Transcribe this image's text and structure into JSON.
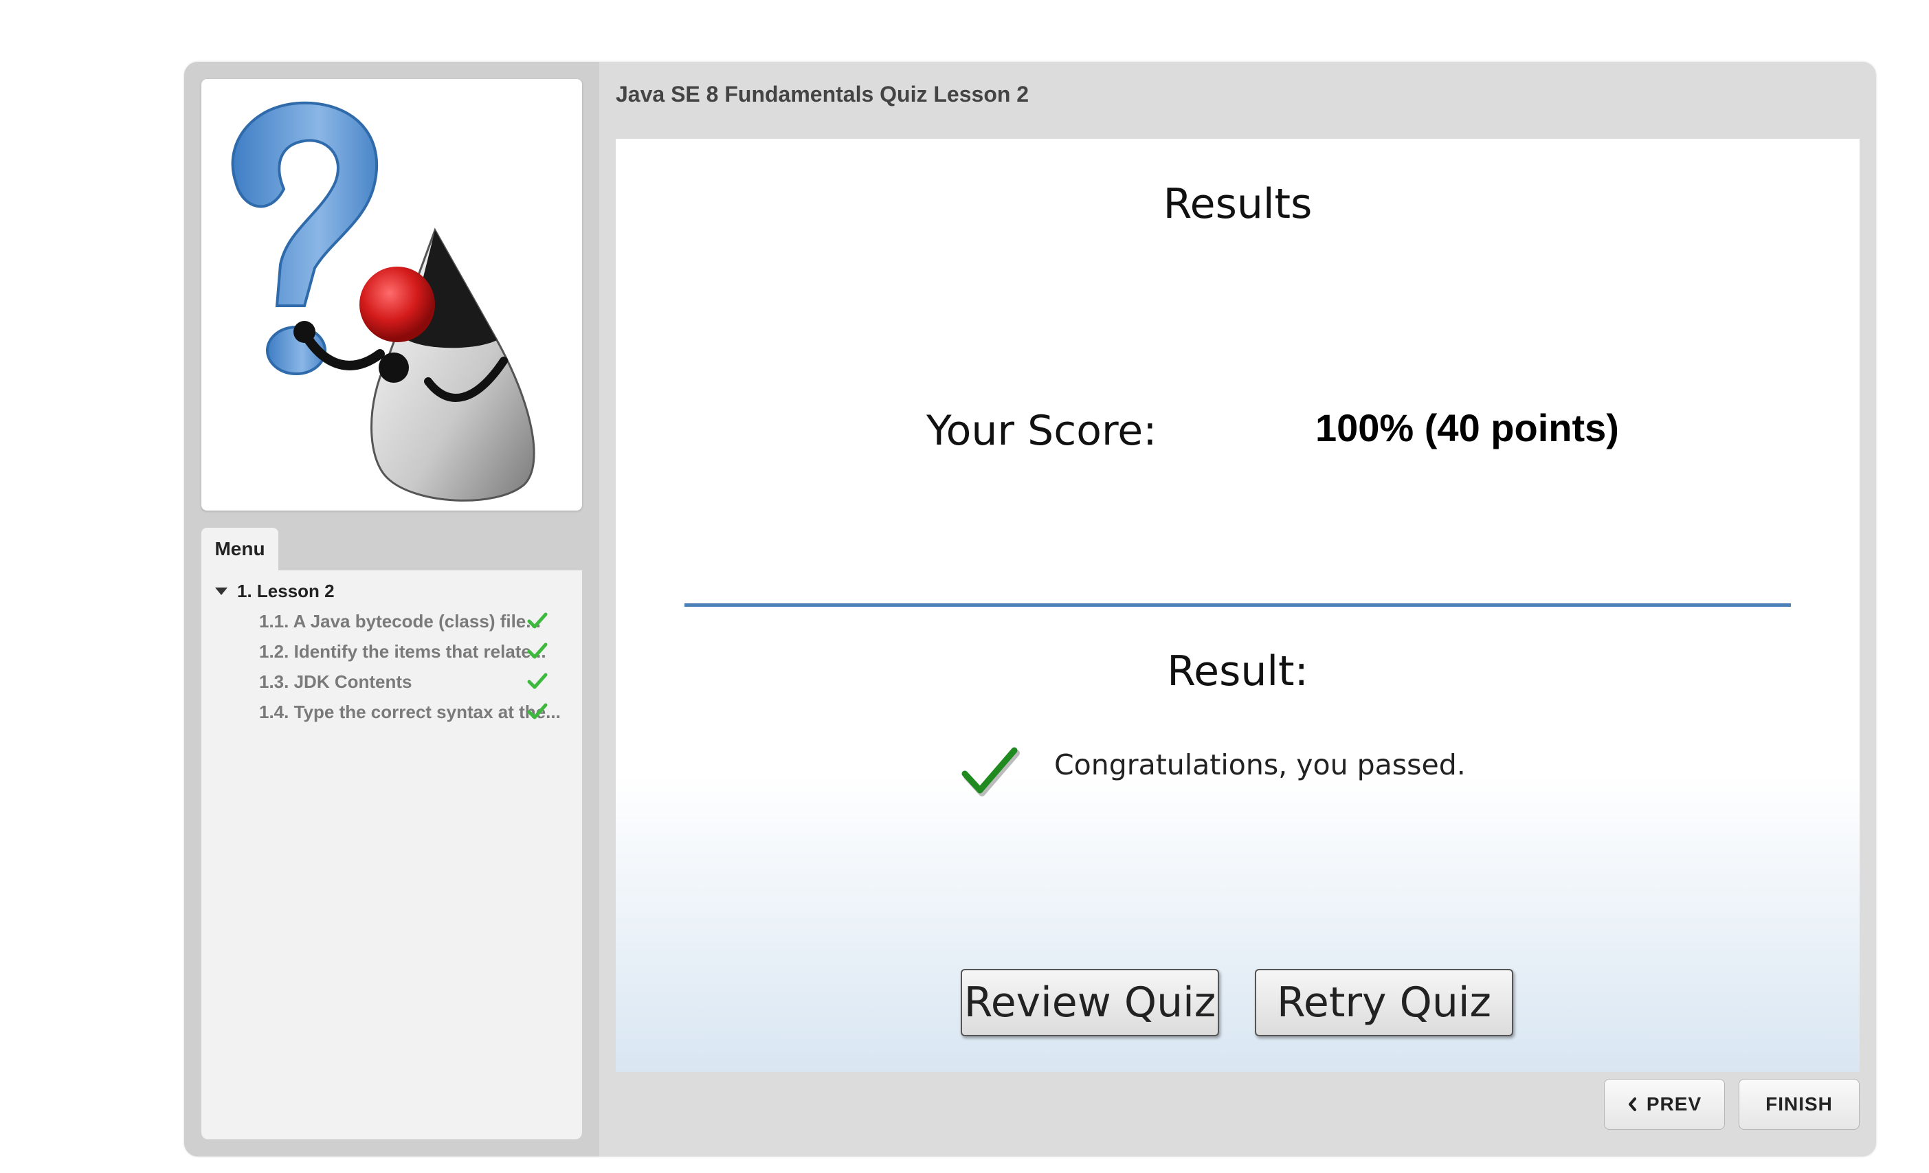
{
  "header": {
    "title": "Java SE 8 Fundamentals Quiz Lesson 2"
  },
  "sidebar": {
    "menu_tab_label": "Menu",
    "lesson": {
      "label": "1. Lesson 2"
    },
    "items": [
      {
        "label": "1.1. A Java bytecode (class) file...",
        "completed": true
      },
      {
        "label": "1.2. Identify the items that relate...",
        "completed": true
      },
      {
        "label": "1.3. JDK Contents",
        "completed": true
      },
      {
        "label": "1.4. Type the correct syntax at the...",
        "completed": true
      }
    ]
  },
  "slide": {
    "title": "Results",
    "score_label": "Your Score:",
    "score_value": "100% (40 points)",
    "result_label": "Result:",
    "result_message": "Congratulations, you passed.",
    "review_button": "Review Quiz",
    "retry_button": "Retry Quiz"
  },
  "nav": {
    "prev_label": "PREV",
    "finish_label": "FINISH"
  },
  "colors": {
    "check_green": "#3db93d",
    "divider_blue": "#4a7fb8"
  }
}
